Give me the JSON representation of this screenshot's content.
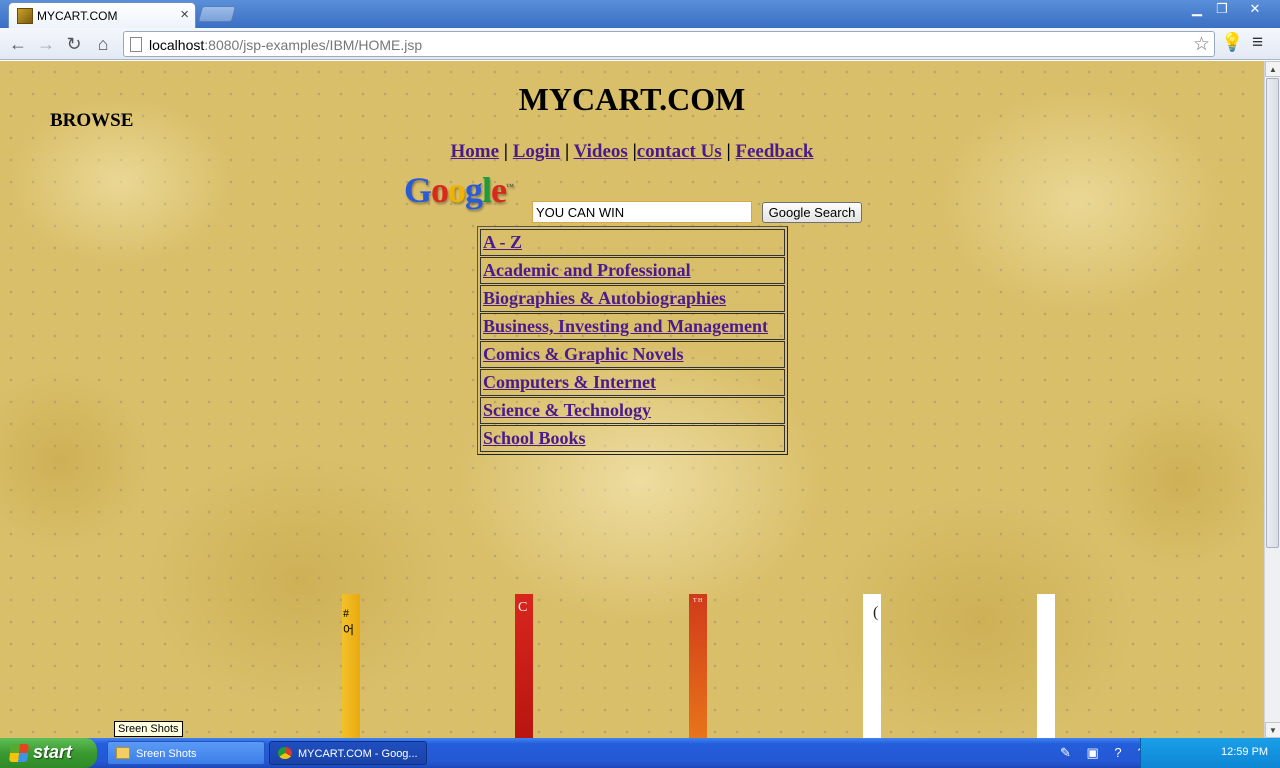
{
  "browser": {
    "tab_title": "MYCART.COM",
    "tab_close": "×",
    "url_host": "localhost",
    "url_rest": ":8080/jsp-examples/IBM/HOME.jsp",
    "window_min": "▁",
    "window_max": "❐",
    "window_close": "✕",
    "icons": {
      "back": "←",
      "forward": "→",
      "reload": "↻",
      "home": "⌂",
      "star": "☆",
      "bulb": "💡",
      "wrench": "≡"
    }
  },
  "page": {
    "site_title": "MYCART.COM",
    "browse_label": "BROWSE",
    "nav": {
      "home": "Home",
      "sep1": " | ",
      "login": "Login",
      "sep2": " | ",
      "videos": "Videos",
      "sep3": " |",
      "contact": "contact Us",
      "sep4": " | ",
      "feedback": "Feedback"
    },
    "google_logo": [
      "G",
      "o",
      "o",
      "g",
      "l",
      "e"
    ],
    "google_tm": "™",
    "search": {
      "value": "YOU CAN WIN",
      "button": "Google Search"
    },
    "categories": [
      "A - Z",
      "Academic and Professional",
      "Biographies & Autobiographies",
      "Business, Investing and Management",
      "Comics & Graphic Novels",
      "Computers & Internet",
      "Science & Technology",
      "School Books"
    ]
  },
  "tooltip": "Sreen Shots",
  "taskbar": {
    "start": "start",
    "tasks": [
      "Sreen Shots",
      "MYCART.COM - Goog..."
    ],
    "tray_icons": "✎ ▣ ? ⇅ ◐ ▲ ■ ◉",
    "clock": "12:59 PM"
  },
  "colors": {
    "link": "#4b1a8c",
    "page_bg": "#d9bf6a",
    "taskbar": "#245edb"
  }
}
